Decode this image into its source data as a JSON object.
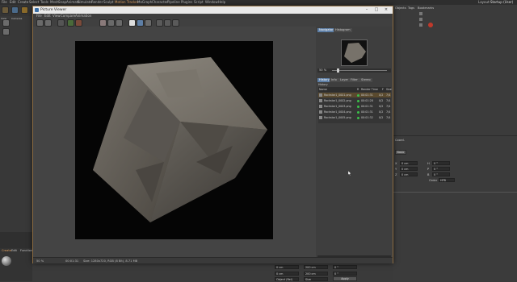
{
  "menubar": {
    "items": [
      "File",
      "Edit",
      "Create",
      "Select",
      "Tools",
      "Mesh",
      "Snap",
      "Animate",
      "Simulate",
      "Render",
      "Sculpt",
      "Motion Tracker",
      "MoGraph",
      "Character",
      "Pipeline",
      "Plugins",
      "Script",
      "Window",
      "Help"
    ],
    "layout_label": "Layout:",
    "layout_value": "Startup (User)"
  },
  "left_panel": {
    "tabs": [
      "View",
      "Cameras",
      "Display"
    ],
    "material_tabs": [
      "Create",
      "Edit",
      "Function"
    ]
  },
  "picture_viewer": {
    "title": "Picture Viewer",
    "menu": [
      "File",
      "Edit",
      "View",
      "Compare",
      "Animation"
    ],
    "side_tabs_top": [
      "Navigator",
      "Histogram"
    ],
    "zoom_value": "50 %",
    "side_tabs_info": [
      "History",
      "Info",
      "Layer",
      "Filter",
      "Stereo"
    ],
    "history_label": "History",
    "history_columns": [
      "Name",
      "R",
      "Render Time",
      "F",
      "Size"
    ],
    "history_rows": [
      {
        "name": "Rockstar1_0001.png",
        "time": "00:01:31",
        "f": "0/2",
        "size": "7/4"
      },
      {
        "name": "Rockstar1_0002.png",
        "time": "00:01:28",
        "f": "0/2",
        "size": "7/4"
      },
      {
        "name": "Rockstar1_0003.png",
        "time": "00:01:31",
        "f": "0/2",
        "size": "7/4"
      },
      {
        "name": "Rockstar1_0004.png",
        "time": "00:01:31",
        "f": "0/2",
        "size": "7/4"
      },
      {
        "name": "Rockstar1_0005.png",
        "time": "00:01:32",
        "f": "0/2",
        "size": "7/4"
      }
    ],
    "status_zoom": "50 %",
    "status_time": "00:01:31",
    "status_info": "Size: 1280x720, RGB (8 Bit), 8.71 MB"
  },
  "right_panel": {
    "tabs": [
      "Objects",
      "Tags",
      "Bookmarks"
    ],
    "attributes_title": "Coord.",
    "attributes_tab": "Basic",
    "coord_rows": [
      {
        "axis": "X",
        "pos": "0 cm",
        "size_label": "H",
        "size": "0 °"
      },
      {
        "axis": "Y",
        "pos": "0 cm",
        "size_label": "P",
        "size": "0 °"
      },
      {
        "axis": "Z",
        "pos": "0 cm",
        "size_label": "B",
        "size": "0 °"
      }
    ],
    "order_label": "Order",
    "order_value": "HPB"
  },
  "coord_manager": {
    "position_value": "0 cm",
    "size_value": "200 cm",
    "rotation_value": "0 °",
    "mode_object": "Object (Rel)",
    "mode_size": "Size",
    "apply_label": "Apply"
  },
  "colors": {
    "accent_orange": "#e0a060",
    "active_tab": "#5e7fa6",
    "status_green": "#3bc14a"
  }
}
